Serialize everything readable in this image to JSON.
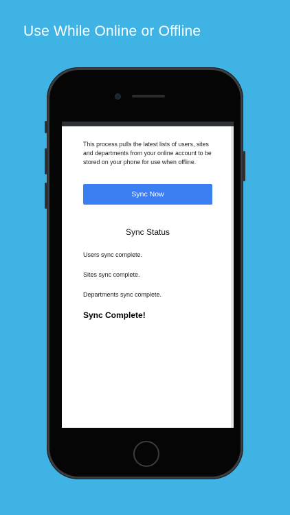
{
  "banner": {
    "headline": "Use While Online or Offline"
  },
  "sync_page": {
    "description": "This process pulls the latest lists of users, sites and departments from your online account to be stored on your phone for use when offline.",
    "sync_button_label": "Sync Now",
    "status_heading": "Sync Status",
    "status_lines": [
      "Users sync complete.",
      "Sites sync complete.",
      "Departments sync complete."
    ],
    "complete_message": "Sync Complete!"
  },
  "colors": {
    "background": "#3eb3e4",
    "button": "#3b7ff3",
    "phone_frame": "#3a3d42"
  }
}
